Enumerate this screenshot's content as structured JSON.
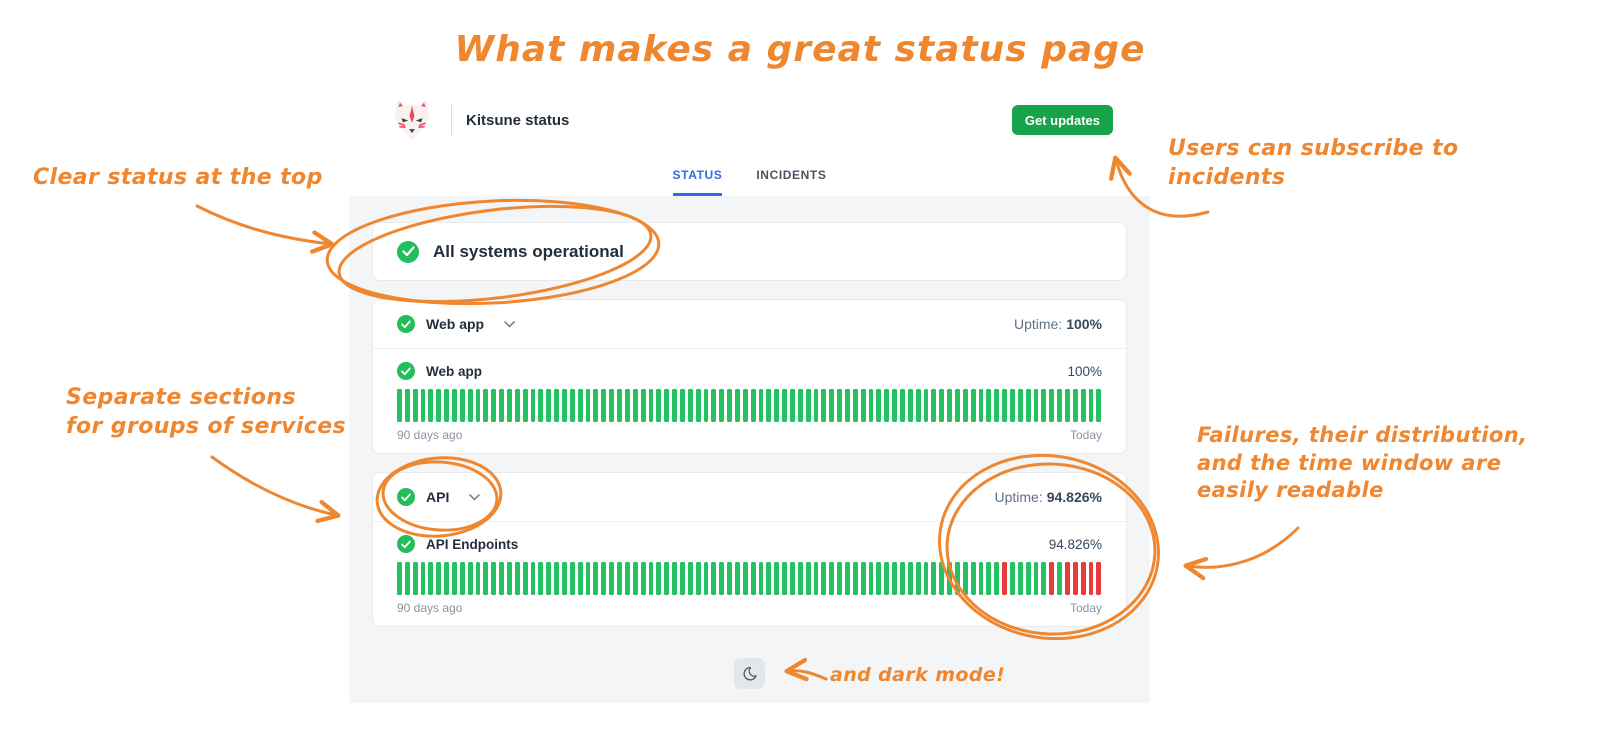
{
  "page_title": "What makes a great status page",
  "colors": {
    "orange": "#ef8630",
    "brand_green": "#18a24a",
    "bar_green": "#23c161",
    "bar_red": "#e93a3a",
    "tab_blue": "#2e6be5",
    "check_green": "#23bd5c"
  },
  "status_page": {
    "brand": "Kitsune status",
    "subscribe_button": "Get updates",
    "tabs": {
      "status": "STATUS",
      "incidents": "INCIDENTS"
    },
    "overall_status": "All systems operational",
    "groups": [
      {
        "name": "Web app",
        "uptime_label": "Uptime:",
        "uptime_value": "100%",
        "service": {
          "name": "Web app",
          "uptime_value": "100%",
          "window_start": "90 days ago",
          "window_end": "Today",
          "bars": {
            "total": 90,
            "down_indices": []
          }
        }
      },
      {
        "name": "API",
        "uptime_label": "Uptime:",
        "uptime_value": "94.826%",
        "service": {
          "name": "API Endpoints",
          "uptime_value": "94.826%",
          "window_start": "90 days ago",
          "window_end": "Today",
          "bars": {
            "total": 90,
            "down_indices": [
              77,
              83,
              85,
              86,
              87,
              88,
              89
            ]
          }
        }
      }
    ]
  },
  "annotations": {
    "clear_status": {
      "lines": [
        "Clear status at the top"
      ]
    },
    "subscribe": {
      "lines": [
        "Users can subscribe to",
        "incidents"
      ]
    },
    "sections": {
      "lines": [
        "Separate sections",
        "for groups of services"
      ]
    },
    "failures": {
      "lines": [
        "Failures, their distribution,",
        "and the time window are",
        "easily readable"
      ]
    },
    "dark_mode": {
      "lines": [
        "and dark mode!"
      ]
    }
  }
}
